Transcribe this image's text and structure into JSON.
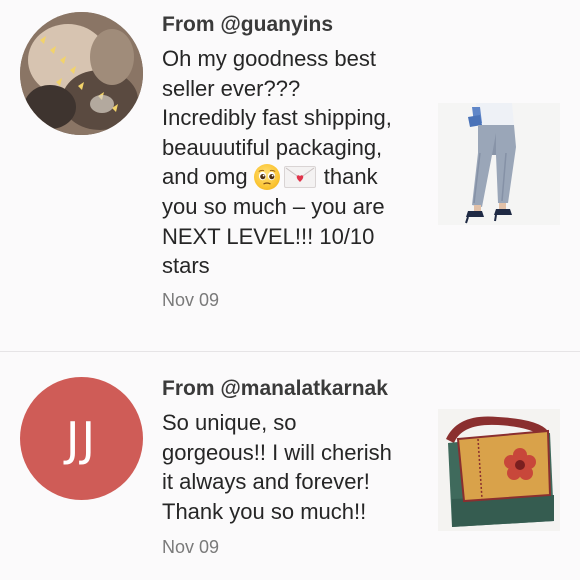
{
  "reviews": [
    {
      "username": "From @guanyins",
      "avatar": {
        "type": "photo",
        "icon": "user-photo-avatar"
      },
      "lines": [
        "Oh my goodness best",
        "seller ever???",
        "Incredibly fast shipping,",
        "beauuutiful packaging,"
      ],
      "line_with_emoji": {
        "before": "and omg",
        "emojis": [
          "pleading-face",
          "love-letter"
        ],
        "after": "thank"
      },
      "lines_after": [
        "you so much – you are",
        "NEXT LEVEL!!! 10/10",
        "stars"
      ],
      "date": "Nov 09",
      "thumbnail": {
        "icon": "gray-jeans-photo"
      }
    },
    {
      "username": "From @manalatkarnak",
      "avatar": {
        "type": "initials",
        "initials": "JJ",
        "color": "#cf5c57"
      },
      "lines": [
        "So unique, so",
        "gorgeous!! I will cherish",
        "it always and forever!",
        "Thank you so much!!"
      ],
      "date": "Nov 09",
      "thumbnail": {
        "icon": "crossbody-bag-photo"
      }
    }
  ]
}
